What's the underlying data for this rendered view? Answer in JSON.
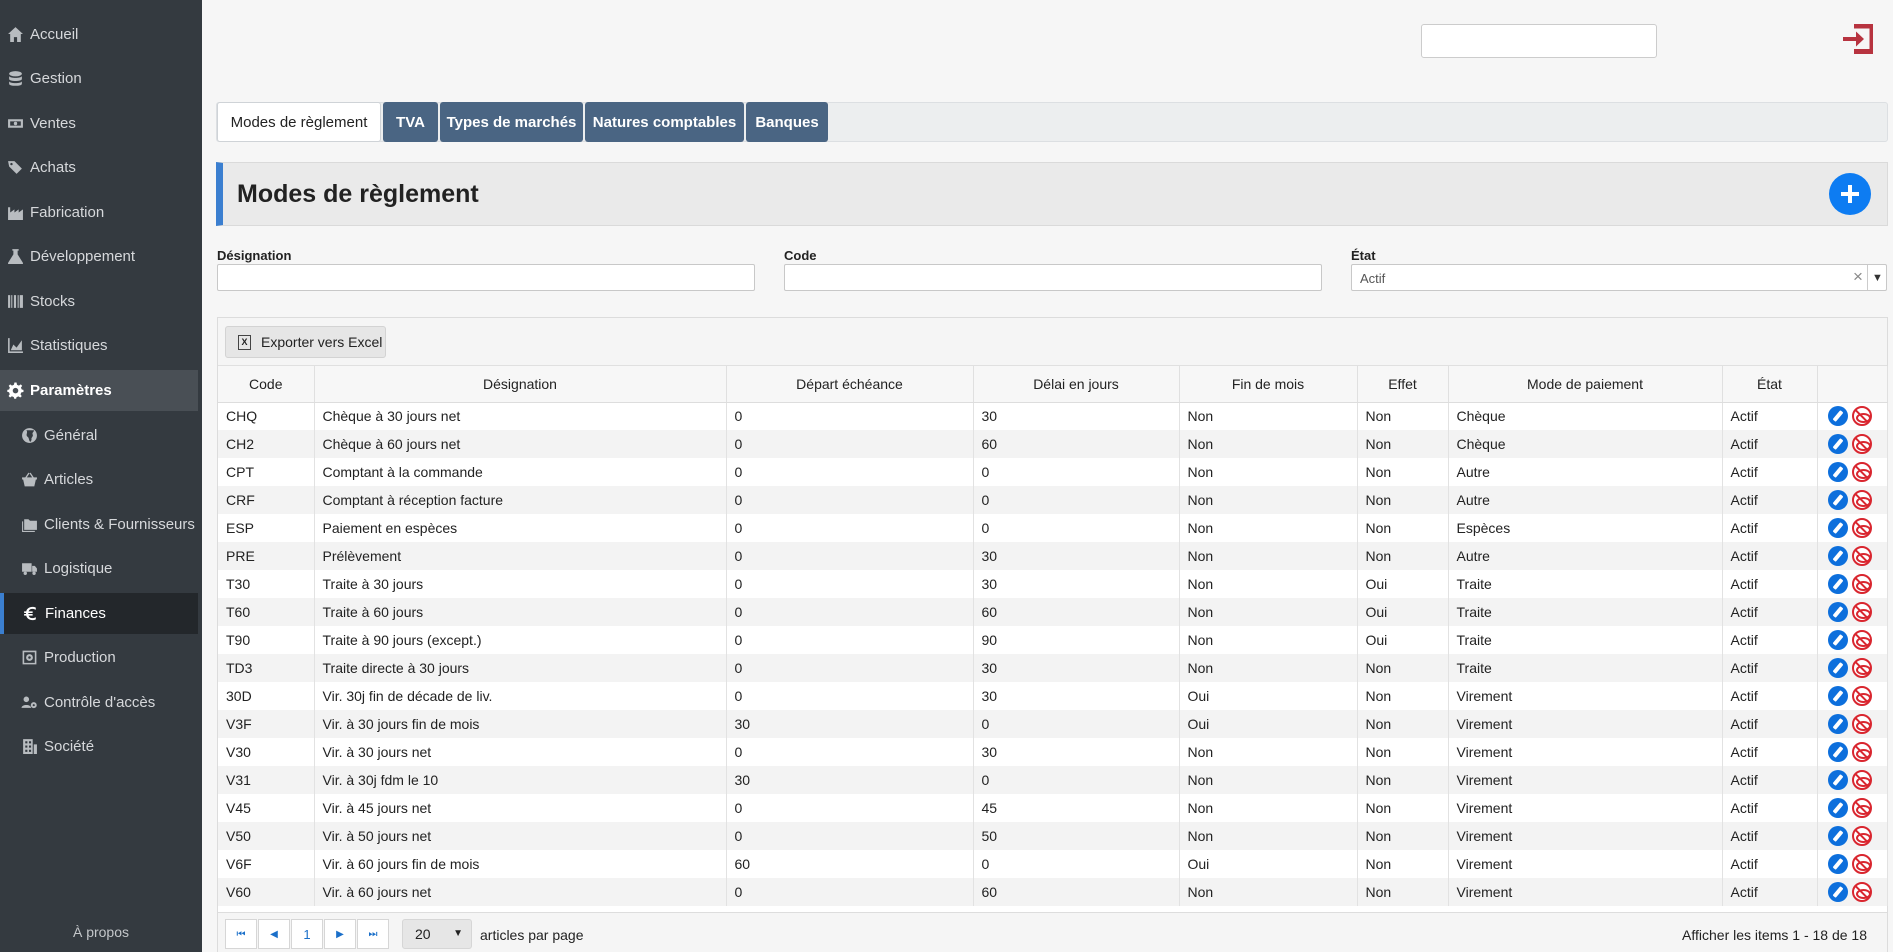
{
  "sidebar": {
    "items": [
      {
        "label": "Accueil",
        "icon": "home-icon"
      },
      {
        "label": "Gestion",
        "icon": "database-icon"
      },
      {
        "label": "Ventes",
        "icon": "money-bill-icon"
      },
      {
        "label": "Achats",
        "icon": "tags-icon"
      },
      {
        "label": "Fabrication",
        "icon": "industry-icon"
      },
      {
        "label": "Développement",
        "icon": "flask-icon"
      },
      {
        "label": "Stocks",
        "icon": "barcode-icon"
      },
      {
        "label": "Statistiques",
        "icon": "chart-area-icon"
      },
      {
        "label": "Paramètres",
        "icon": "gear-icon"
      },
      {
        "label": "Général",
        "icon": "globe-icon"
      },
      {
        "label": "Articles",
        "icon": "basket-icon"
      },
      {
        "label": "Clients & Fournisseurs",
        "icon": "folders-icon"
      },
      {
        "label": "Logistique",
        "icon": "truck-icon"
      },
      {
        "label": "Finances",
        "icon": "euro-icon"
      },
      {
        "label": "Production",
        "icon": "cog-box-icon"
      },
      {
        "label": "Contrôle d'accès",
        "icon": "users-gear-icon"
      },
      {
        "label": "Société",
        "icon": "building-icon"
      }
    ],
    "about": "À propos"
  },
  "tabs": [
    "Modes de règlement",
    "TVA",
    "Types de marchés",
    "Natures comptables",
    "Banques"
  ],
  "page_title": "Modes de règlement",
  "filters": {
    "designation_label": "Désignation",
    "code_label": "Code",
    "etat_label": "État",
    "etat_value": "Actif"
  },
  "toolbar": {
    "export_label": "Exporter vers Excel"
  },
  "table": {
    "headers": [
      "Code",
      "Désignation",
      "Départ échéance",
      "Délai en jours",
      "Fin de mois",
      "Effet",
      "Mode de paiement",
      "État",
      ""
    ],
    "rows": [
      [
        "CHQ",
        "Chèque à 30 jours net",
        "0",
        "30",
        "Non",
        "Non",
        "Chèque",
        "Actif"
      ],
      [
        "CH2",
        "Chèque à 60 jours net",
        "0",
        "60",
        "Non",
        "Non",
        "Chèque",
        "Actif"
      ],
      [
        "CPT",
        "Comptant à la commande",
        "0",
        "0",
        "Non",
        "Non",
        "Autre",
        "Actif"
      ],
      [
        "CRF",
        "Comptant à réception facture",
        "0",
        "0",
        "Non",
        "Non",
        "Autre",
        "Actif"
      ],
      [
        "ESP",
        "Paiement en espèces",
        "0",
        "0",
        "Non",
        "Non",
        "Espèces",
        "Actif"
      ],
      [
        "PRE",
        "Prélèvement",
        "0",
        "30",
        "Non",
        "Non",
        "Autre",
        "Actif"
      ],
      [
        "T30",
        "Traite à 30 jours",
        "0",
        "30",
        "Non",
        "Oui",
        "Traite",
        "Actif"
      ],
      [
        "T60",
        "Traite à 60 jours",
        "0",
        "60",
        "Non",
        "Oui",
        "Traite",
        "Actif"
      ],
      [
        "T90",
        "Traite à 90 jours (except.)",
        "0",
        "90",
        "Non",
        "Oui",
        "Traite",
        "Actif"
      ],
      [
        "TD3",
        "Traite directe à 30 jours",
        "0",
        "30",
        "Non",
        "Non",
        "Traite",
        "Actif"
      ],
      [
        "30D",
        "Vir. 30j fin de décade de liv.",
        "0",
        "30",
        "Oui",
        "Non",
        "Virement",
        "Actif"
      ],
      [
        "V3F",
        "Vir. à 30 jours fin de mois",
        "30",
        "0",
        "Oui",
        "Non",
        "Virement",
        "Actif"
      ],
      [
        "V30",
        "Vir. à 30 jours net",
        "0",
        "30",
        "Non",
        "Non",
        "Virement",
        "Actif"
      ],
      [
        "V31",
        "Vir. à 30j fdm le 10",
        "30",
        "0",
        "Non",
        "Non",
        "Virement",
        "Actif"
      ],
      [
        "V45",
        "Vir. à 45 jours net",
        "0",
        "45",
        "Non",
        "Non",
        "Virement",
        "Actif"
      ],
      [
        "V50",
        "Vir. à 50 jours net",
        "0",
        "50",
        "Non",
        "Non",
        "Virement",
        "Actif"
      ],
      [
        "V6F",
        "Vir. à 60 jours fin de mois",
        "60",
        "0",
        "Oui",
        "Non",
        "Virement",
        "Actif"
      ],
      [
        "V60",
        "Vir. à 60 jours net",
        "0",
        "60",
        "Non",
        "Non",
        "Virement",
        "Actif"
      ]
    ]
  },
  "pager": {
    "current_page": "1",
    "page_size": "20",
    "page_size_label": "articles par page",
    "info": "Afficher les items 1 - 18 de 18"
  },
  "colors": {
    "sidebar_bg": "#343a40",
    "tab_inactive": "#4a6583",
    "accent": "#3b7fd0",
    "add_button": "#0d7cf2",
    "edit_action": "#0d6fdc",
    "hide_action": "#d9262f"
  }
}
